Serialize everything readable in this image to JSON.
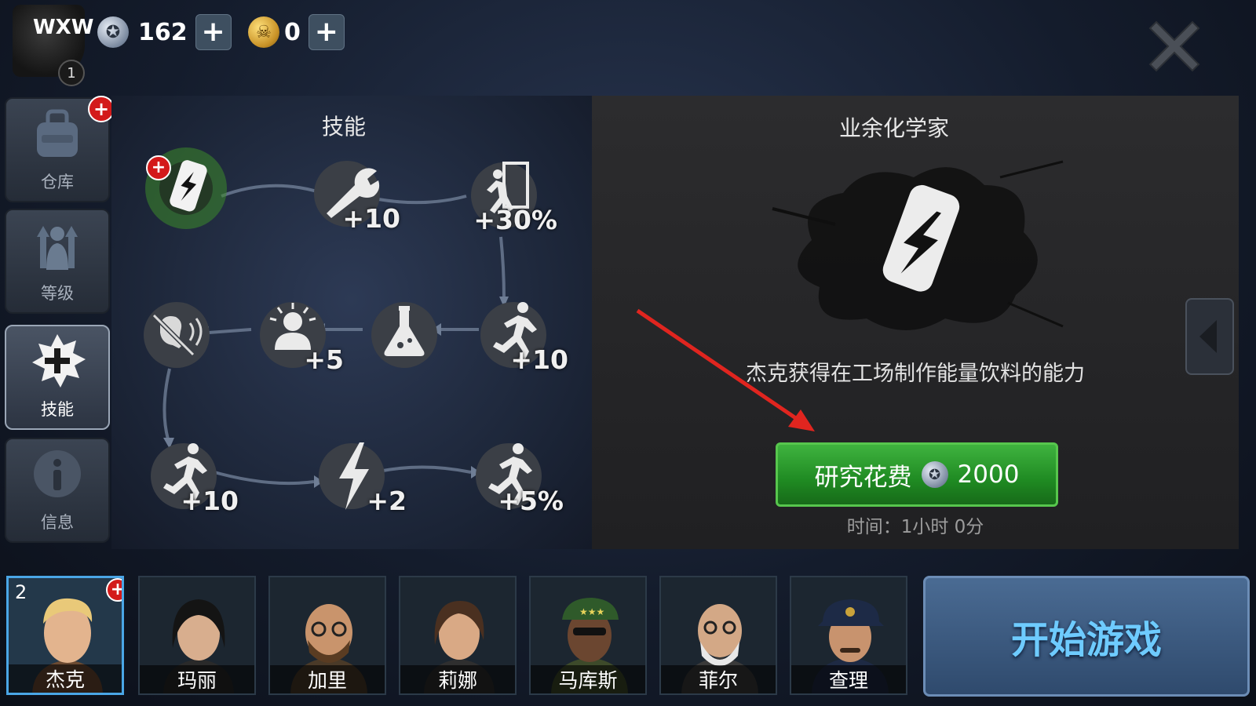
{
  "player": {
    "name": "WXW",
    "level": "1"
  },
  "currency": {
    "silver": "162",
    "gold": "0"
  },
  "nav": [
    {
      "label": "仓库",
      "icon": "backpack-icon"
    },
    {
      "label": "等级",
      "icon": "level-up-icon"
    },
    {
      "label": "技能",
      "icon": "skill-icon"
    },
    {
      "label": "信息",
      "icon": "info-icon"
    }
  ],
  "skill_panel": {
    "title": "技能",
    "nodes": [
      {
        "icon": "energy-drink-icon",
        "bonus": ""
      },
      {
        "icon": "wrench-icon",
        "bonus": "+10"
      },
      {
        "icon": "escape-door-icon",
        "bonus": "+30%"
      },
      {
        "icon": "sprint-icon",
        "bonus": "+10"
      },
      {
        "icon": "flask-icon",
        "bonus": ""
      },
      {
        "icon": "alert-person-icon",
        "bonus": "+5"
      },
      {
        "icon": "silent-icon",
        "bonus": ""
      },
      {
        "icon": "run-icon",
        "bonus": "+10"
      },
      {
        "icon": "lightning-icon",
        "bonus": "+2"
      },
      {
        "icon": "run-fast-icon",
        "bonus": "+5%"
      }
    ]
  },
  "detail": {
    "title": "业余化学家",
    "description": "杰克获得在工场制作能量饮料的能力",
    "research_label": "研究花费",
    "research_cost": "2000",
    "time": "时间：1小时 0分"
  },
  "characters": [
    {
      "name": "杰克",
      "num": "2"
    },
    {
      "name": "玛丽"
    },
    {
      "name": "加里"
    },
    {
      "name": "莉娜"
    },
    {
      "name": "马库斯"
    },
    {
      "name": "菲尔"
    },
    {
      "name": "查理"
    }
  ],
  "start_button": "开始游戏",
  "colors": {
    "accent_green": "#2e9e31",
    "start_text": "#6ecbff",
    "badge_red": "#d31a1a"
  }
}
